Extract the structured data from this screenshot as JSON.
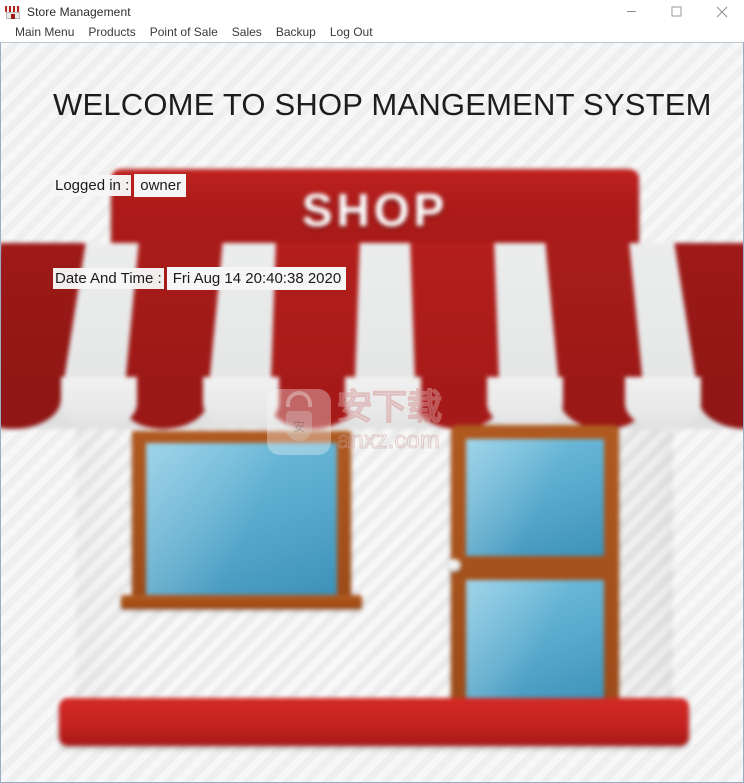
{
  "window": {
    "title": "Store Management",
    "icon": "shop-icon",
    "controls": [
      {
        "name": "minimize-button",
        "glyph": "minimize-icon"
      },
      {
        "name": "maximize-button",
        "glyph": "maximize-icon"
      },
      {
        "name": "close-button",
        "glyph": "close-icon"
      }
    ]
  },
  "menubar": {
    "items": [
      {
        "label": "Main Menu"
      },
      {
        "label": "Products"
      },
      {
        "label": "Point of Sale"
      },
      {
        "label": "Sales"
      },
      {
        "label": "Backup"
      },
      {
        "label": "Log Out"
      }
    ]
  },
  "main": {
    "heading": "WELCOME TO SHOP MANGEMENT SYSTEM",
    "logged_in": {
      "label": "Logged in :",
      "value": "owner"
    },
    "datetime": {
      "label": "Date And Time :",
      "value": "Fri Aug 14 20:40:38 2020"
    }
  },
  "illustration": {
    "sign_text": "SHOP",
    "colors": {
      "awning_red": "#bf2220",
      "awning_red_dark": "#a81a18",
      "awning_white": "#f0f0f0",
      "store_body": "#f2f2f2",
      "window_frame": "#a8511c",
      "window_glass": "#58a9cc",
      "base_bar": "#c42220"
    }
  },
  "watermark": {
    "bag_mark": "安",
    "chinese_text": "安下载",
    "domain": "anxz.com"
  }
}
